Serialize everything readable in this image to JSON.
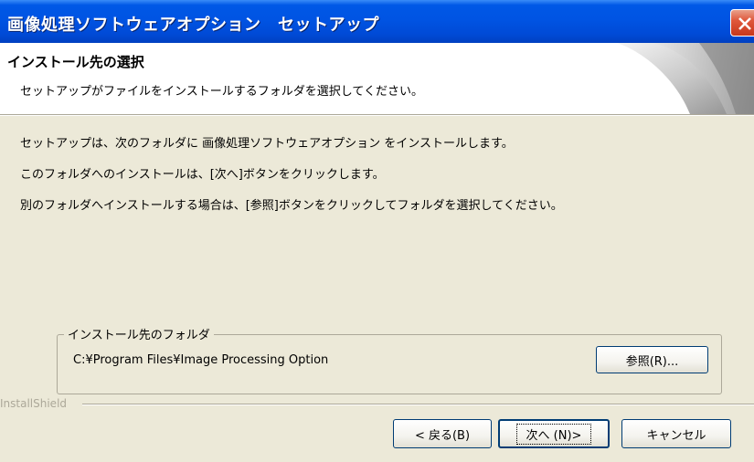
{
  "window": {
    "title": "画像処理ソフトウェアオプション　セットアップ"
  },
  "header": {
    "title": "インストール先の選択",
    "subtitle": "セットアップがファイルをインストールするフォルダを選択してください。"
  },
  "body": {
    "line1": "セットアップは、次のフォルダに 画像処理ソフトウェアオプション をインストールします。",
    "line2": "このフォルダへのインストールは、[次へ]ボタンをクリックします。",
    "line3": "別のフォルダへインストールする場合は、[参照]ボタンをクリックしてフォルダを選択してください。"
  },
  "destination": {
    "group_label": "インストール先のフォルダ",
    "path": "C:¥Program Files¥Image Processing Option",
    "browse_label": "参照(R)..."
  },
  "footer": {
    "brand": "InstallShield",
    "back_label": "< 戻る(B)",
    "next_label": "次へ (N)>",
    "cancel_label": "キャンセル"
  },
  "icons": {
    "close": "close-icon",
    "header_art": "setup-graphic-icon"
  },
  "colors": {
    "titlebar": "#0054e3",
    "dialog_bg": "#ece9d8",
    "close_button": "#e0583c",
    "button_border": "#003c74"
  }
}
